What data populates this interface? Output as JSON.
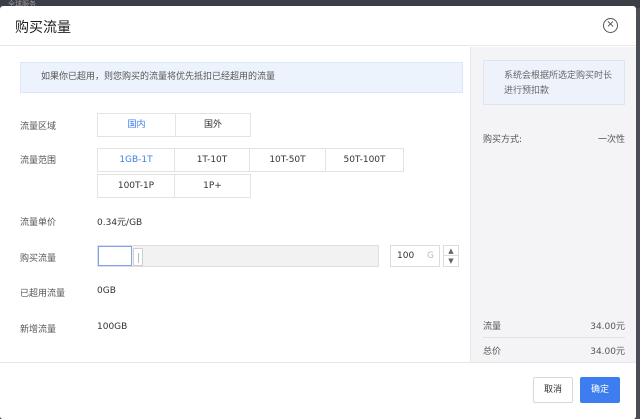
{
  "backdrop": {
    "text": "全球服务"
  },
  "dialog": {
    "title": "购买流量",
    "close_icon": "×"
  },
  "notice": {
    "text": "如果你已超用，则您购买的流量将优先抵扣已经超用的流量"
  },
  "region": {
    "label": "流量区域",
    "options": [
      "国内",
      "国外"
    ],
    "selected": "国内"
  },
  "range": {
    "label": "流量范围",
    "options_row1": [
      "1GB-1T",
      "1T-10T",
      "10T-50T",
      "50T-100T"
    ],
    "options_row2": [
      "100T-1P",
      "1P+"
    ],
    "selected": "1GB-1T"
  },
  "unit_price": {
    "label": "流量单价",
    "value": "0.34元/GB"
  },
  "purchase": {
    "label": "购买流量",
    "slider_fraction": 0.12,
    "quantity": "100",
    "unit": "G",
    "step_up": "▲",
    "step_down": "▼"
  },
  "overused": {
    "label": "已超用流量",
    "value": "0GB"
  },
  "added": {
    "label": "新增流量",
    "value": "100GB"
  },
  "sidebar": {
    "tip": "系统会根据所选定购买时长进行预扣款",
    "payment_label": "购买方式:",
    "payment_value": "一次性",
    "traffic_label": "流量",
    "traffic_value": "34.00元",
    "total_label": "总价",
    "total_value": "34.00元"
  },
  "footer": {
    "cancel_label": "取消",
    "confirm_label": "确定"
  },
  "colors": {
    "accent": "#3e7df0",
    "notice_bg": "#edf3fd",
    "sidebar_bg": "#f4f4f6"
  }
}
